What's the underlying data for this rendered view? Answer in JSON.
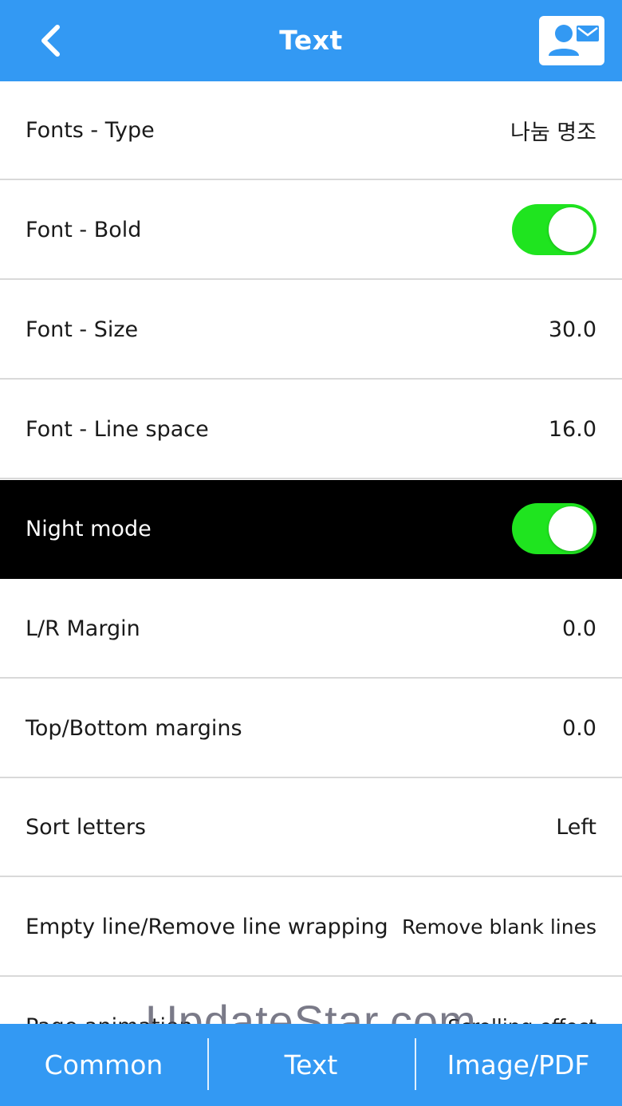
{
  "header": {
    "title": "Text",
    "back_icon": "chevron-left-icon",
    "contact_icon": "contact-card-icon"
  },
  "rows": [
    {
      "label": "Fonts - Type",
      "value": "나눔 명조"
    },
    {
      "label": "Font - Bold",
      "toggle": true
    },
    {
      "label": "Font - Size",
      "value": "30.0"
    },
    {
      "label": "Font - Line space",
      "value": "16.0"
    },
    {
      "label": "Night mode",
      "toggle": true
    },
    {
      "label": "L/R Margin",
      "value": "0.0"
    },
    {
      "label": "Top/Bottom margins",
      "value": "0.0"
    },
    {
      "label": "Sort letters",
      "value": "Left"
    },
    {
      "label": "Empty line/Remove line wrapping",
      "value": "Remove blank lines"
    },
    {
      "label": "Page animation",
      "value": "Scrolling effect"
    }
  ],
  "watermark": "UpdateStar.com",
  "tabs": [
    {
      "label": "Common"
    },
    {
      "label": "Text"
    },
    {
      "label": "Image/PDF"
    }
  ],
  "colors": {
    "accent": "#3399f3",
    "toggle_on": "#1fe41f",
    "night_row": "#000000"
  }
}
